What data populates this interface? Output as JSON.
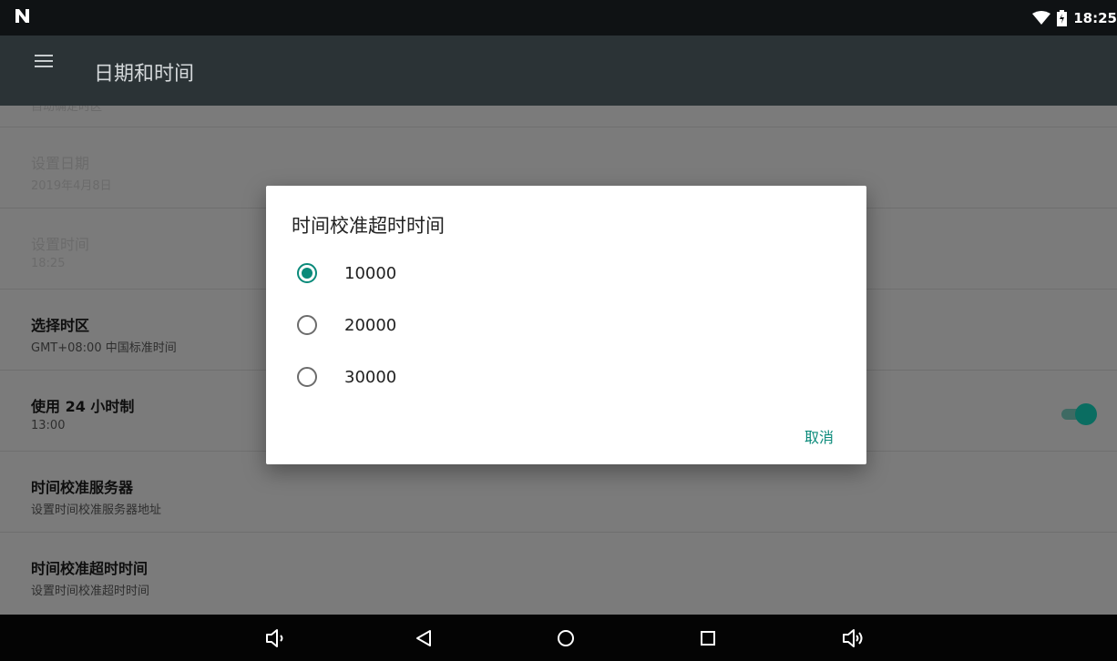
{
  "status_bar": {
    "time": "18:25",
    "icons": [
      "notification-n-icon",
      "wifi-icon",
      "battery-icon"
    ]
  },
  "app_bar": {
    "title": "日期和时间",
    "icon": "hamburger-menu-icon"
  },
  "settings": {
    "cutoff_text": "自动确定时区",
    "rows": [
      {
        "title": "设置日期",
        "subtitle": "2019年4月8日",
        "enabled": false
      },
      {
        "title": "设置时间",
        "subtitle": "18:25",
        "enabled": false
      },
      {
        "title": "选择时区",
        "subtitle": "GMT+08:00 中国标准时间",
        "enabled": true
      },
      {
        "title": "使用 24 小时制",
        "subtitle": "13:00",
        "enabled": true,
        "toggle_on": true
      },
      {
        "title": "时间校准服务器",
        "subtitle": "设置时间校准服务器地址",
        "enabled": true
      },
      {
        "title": "时间校准超时时间",
        "subtitle": "设置时间校准超时时间",
        "enabled": true
      }
    ]
  },
  "dialog": {
    "title": "时间校准超时时间",
    "options": [
      {
        "label": "10000",
        "selected": true
      },
      {
        "label": "20000",
        "selected": false
      },
      {
        "label": "30000",
        "selected": false
      }
    ],
    "cancel_label": "取消"
  },
  "nav_bar": {
    "icons": [
      "volume-down-icon",
      "back-icon",
      "home-icon",
      "recents-icon",
      "volume-up-icon"
    ]
  },
  "colors": {
    "accent": "#0a8a7a",
    "app_bar": "#2b3336",
    "status_bar": "#0f1214",
    "nav_bar": "#040404"
  }
}
